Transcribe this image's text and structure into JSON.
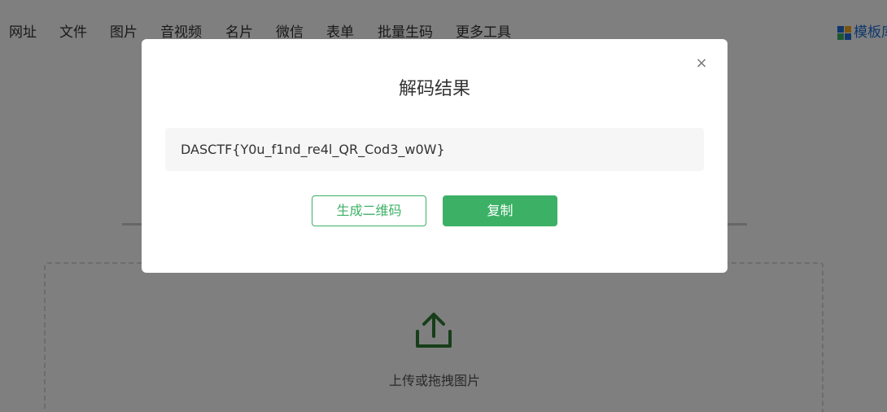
{
  "nav": {
    "items": [
      "网址",
      "文件",
      "图片",
      "音视频",
      "名片",
      "微信",
      "表单",
      "批量生码",
      "更多工具"
    ],
    "right_label": "模板库",
    "colors": {
      "link": "#1e6fd6",
      "grid_icon": [
        "#1e6fd6",
        "#f5a623",
        "#3cb166",
        "#1e6fd6"
      ]
    }
  },
  "upload": {
    "icon": "upload-icon",
    "label": "上传或拖拽图片",
    "icon_color": "#2e7d32"
  },
  "modal": {
    "title": "解码结果",
    "close_label": "×",
    "result_text": "DASCTF{Y0u_f1nd_re4l_QR_Cod3_w0W}",
    "generate_button": "生成二维码",
    "copy_button": "复制",
    "accent_color": "#3cb166"
  }
}
